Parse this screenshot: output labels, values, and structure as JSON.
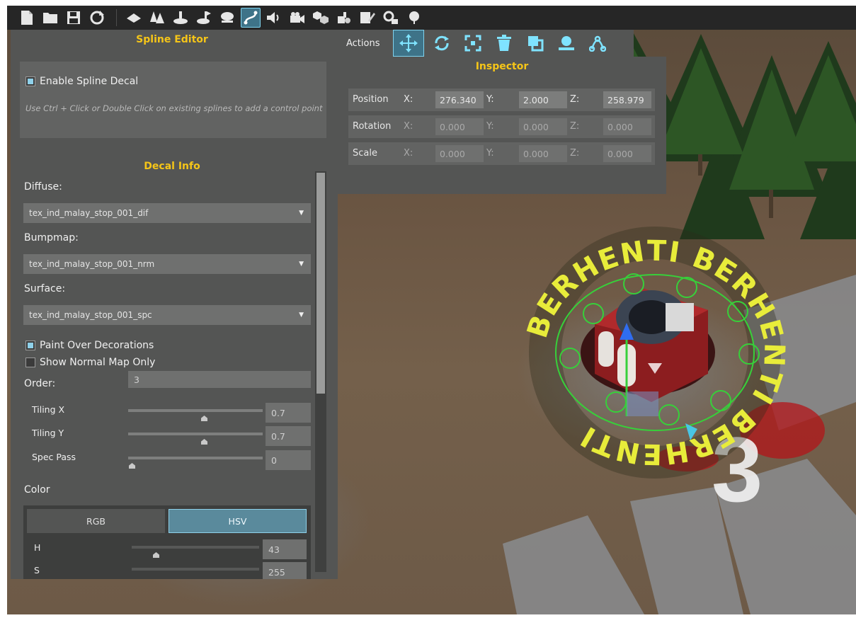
{
  "toolbar": {
    "icons": [
      "new-file-icon",
      "open-folder-icon",
      "save-icon",
      "refresh-icon",
      "terrain-icon",
      "trees-icon",
      "object-icon",
      "spawn-icon",
      "cloud-icon",
      "spline-icon",
      "sound-icon",
      "camera-icon",
      "resources-icon",
      "props-icon",
      "paint-icon",
      "settings-icon",
      "tree-alt-icon"
    ],
    "active": "spline-icon"
  },
  "spline_editor": {
    "title": "Spline Editor",
    "enable_label": "Enable Spline Decal",
    "hint": "Use Ctrl + Click or Double Click on existing splines to add a control point",
    "decal_info_title": "Decal Info",
    "diffuse_label": "Diffuse:",
    "diffuse_value": "tex_ind_malay_stop_001_dif",
    "bumpmap_label": "Bumpmap:",
    "bumpmap_value": "tex_ind_malay_stop_001_nrm",
    "surface_label": "Surface:",
    "surface_value": "tex_ind_malay_stop_001_spc",
    "paint_over_label": "Paint Over Decorations",
    "paint_over_checked": true,
    "normal_map_label": "Show Normal Map Only",
    "normal_map_checked": false,
    "order_label": "Order:",
    "order_value": "3",
    "tiling_x_label": "Tiling X",
    "tiling_x_value": "0.7",
    "tiling_y_label": "Tiling Y",
    "tiling_y_value": "0.7",
    "spec_pass_label": "Spec Pass",
    "spec_pass_value": "0",
    "color_label": "Color",
    "rgb_tab": "RGB",
    "hsv_tab": "HSV",
    "h_label": "H",
    "h_value": "43",
    "s_label": "S",
    "s_value": "255"
  },
  "actions": {
    "label": "Actions",
    "icons": [
      "move-icon",
      "rotate-icon",
      "scale-icon",
      "delete-icon",
      "duplicate-icon",
      "snap-to-ground-icon",
      "spline-nodes-icon"
    ],
    "active": "move-icon"
  },
  "inspector": {
    "title": "Inspector",
    "position": {
      "label": "Position",
      "x": "276.340",
      "y": "2.000",
      "z": "258.979"
    },
    "rotation": {
      "label": "Rotation",
      "x": "0.000",
      "y": "0.000",
      "z": "0.000"
    },
    "scale": {
      "label": "Scale",
      "x": "0.000",
      "y": "0.000",
      "z": "0.000"
    },
    "axis_x": "X:",
    "axis_y": "Y:",
    "axis_z": "Z:"
  },
  "scene": {
    "decal_text": "BERHENTI",
    "ground_number": "3"
  },
  "colors": {
    "accent_yellow": "#f5c518",
    "active_blue": "#3e7388",
    "panel_bg": "#545554",
    "decal_yellow": "#e8ec3a",
    "spline_green": "#37d03a"
  }
}
